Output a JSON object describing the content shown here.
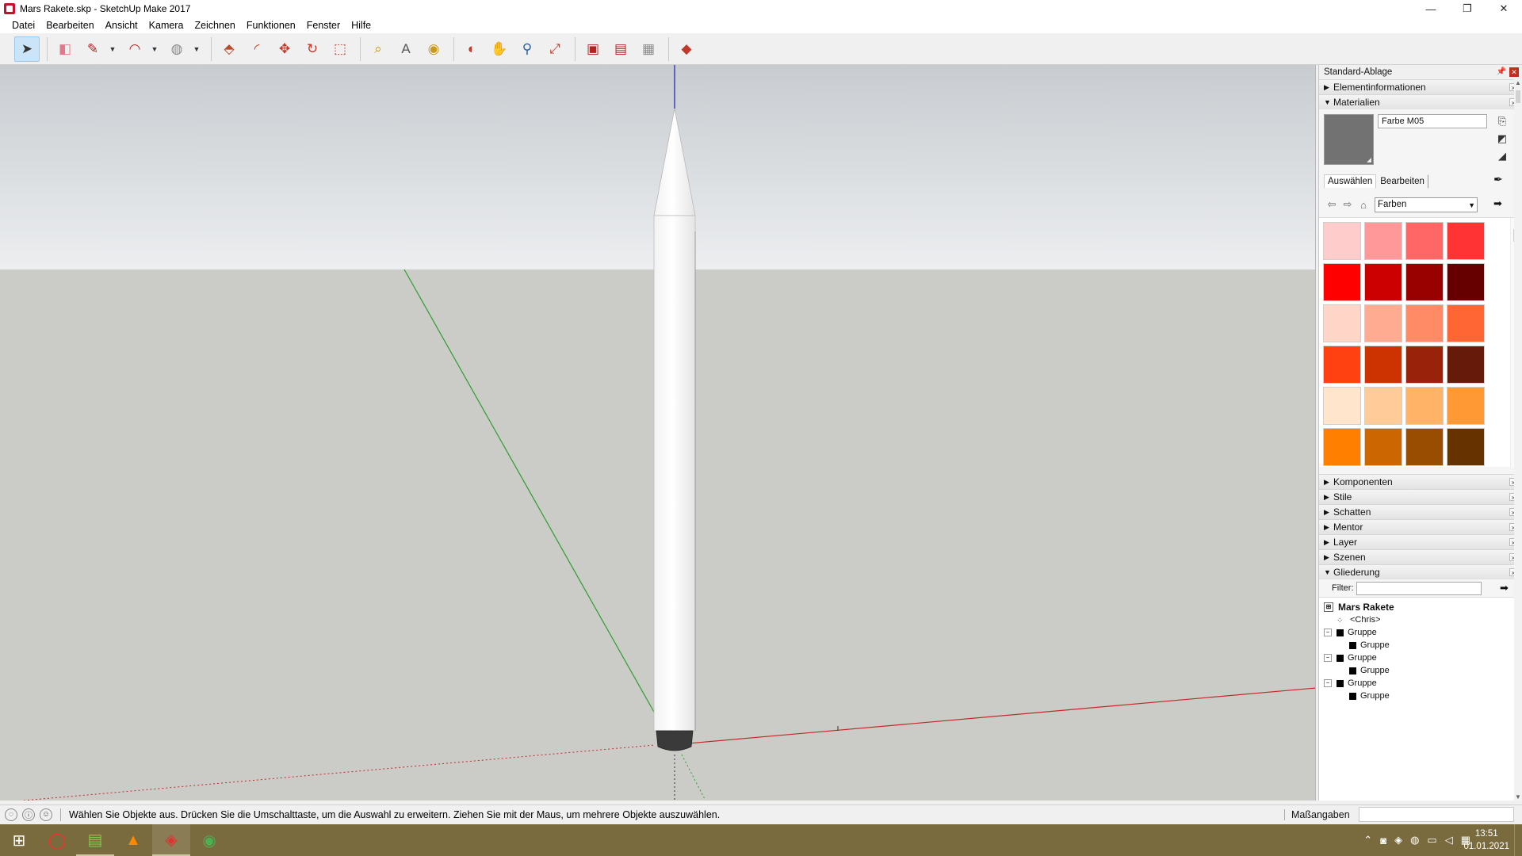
{
  "window": {
    "title": "Mars Rakete.skp - SketchUp Make 2017",
    "controls": {
      "minimize": "—",
      "maximize": "❐",
      "close": "✕"
    }
  },
  "menubar": {
    "items": [
      "Datei",
      "Bearbeiten",
      "Ansicht",
      "Kamera",
      "Zeichnen",
      "Funktionen",
      "Fenster",
      "Hilfe"
    ]
  },
  "toolbar": {
    "tools": [
      {
        "icon": "select-arrow-icon",
        "glyph": "➤",
        "color": "#333333"
      },
      {
        "icon": "eraser-icon",
        "glyph": "◧",
        "color": "#e07a8a"
      },
      {
        "icon": "pencil-line-icon",
        "glyph": "✎",
        "color": "#b22222"
      },
      {
        "icon": "arc-icon",
        "glyph": "◠",
        "color": "#b22222"
      },
      {
        "icon": "shapes-icon",
        "glyph": "◍",
        "color": "#8a8a8a"
      },
      {
        "icon": "push-pull-icon",
        "glyph": "⬘",
        "color": "#b84a2a"
      },
      {
        "icon": "offset-icon",
        "glyph": "◜",
        "color": "#c04020"
      },
      {
        "icon": "move-icon",
        "glyph": "✥",
        "color": "#c0392b"
      },
      {
        "icon": "rotate-icon",
        "glyph": "↻",
        "color": "#c0392b"
      },
      {
        "icon": "scale-icon",
        "glyph": "⬚",
        "color": "#c0392b"
      },
      {
        "icon": "tape-measure-icon",
        "glyph": "⌕",
        "color": "#c99a1a"
      },
      {
        "icon": "text-icon",
        "glyph": "A",
        "color": "#555555"
      },
      {
        "icon": "paint-bucket-icon",
        "glyph": "◉",
        "color": "#c99a1a"
      },
      {
        "icon": "orbit-icon",
        "glyph": "◐",
        "color": "#c0392b"
      },
      {
        "icon": "pan-icon",
        "glyph": "✋",
        "color": "#d4a017"
      },
      {
        "icon": "zoom-icon",
        "glyph": "⚲",
        "color": "#2b5fa6"
      },
      {
        "icon": "zoom-extents-icon",
        "glyph": "⤢",
        "color": "#c0392b"
      },
      {
        "icon": "3d-warehouse-icon",
        "glyph": "▣",
        "color": "#b22222"
      },
      {
        "icon": "extension-warehouse-icon",
        "glyph": "▤",
        "color": "#b22222"
      },
      {
        "icon": "layout-send-icon",
        "glyph": "▦",
        "color": "#8a8a8a"
      },
      {
        "icon": "extension-ruby-icon",
        "glyph": "◆",
        "color": "#c0392b"
      }
    ]
  },
  "tray": {
    "title": "Standard-Ablage",
    "panels": {
      "element_info": "Elementinformationen",
      "materials": "Materialien",
      "components": "Komponenten",
      "styles": "Stile",
      "shadows": "Schatten",
      "mentor": "Mentor",
      "layers": "Layer",
      "scenes": "Szenen",
      "outliner": "Gliederung"
    },
    "materials": {
      "current_name": "Farbe M05",
      "preview_color": "#727272",
      "tab_select": "Auswählen",
      "tab_edit": "Bearbeiten",
      "collection": "Farben",
      "swatches": [
        "#ffcccc",
        "#ff9999",
        "#ff6666",
        "#ff3333",
        "#ff0000",
        "#cc0000",
        "#990000",
        "#660000",
        "#ffd5c8",
        "#ffab91",
        "#ff8a65",
        "#ff6633",
        "#ff4010",
        "#cc3300",
        "#99220a",
        "#661a0a",
        "#ffe5cc",
        "#ffcc99",
        "#ffb366",
        "#ff9933",
        "#ff8000",
        "#cc6600",
        "#994d00",
        "#663300"
      ]
    },
    "outliner": {
      "filter_label": "Filter:",
      "filter_value": "",
      "model_name": "Mars Rakete",
      "items": [
        {
          "label": "<Chris>",
          "level": 1,
          "kind": "component",
          "expander": ""
        },
        {
          "label": "Gruppe",
          "level": 1,
          "kind": "group",
          "expander": "−"
        },
        {
          "label": "Gruppe",
          "level": 2,
          "kind": "group",
          "expander": ""
        },
        {
          "label": "Gruppe",
          "level": 1,
          "kind": "group",
          "expander": "−"
        },
        {
          "label": "Gruppe",
          "level": 2,
          "kind": "group",
          "expander": ""
        },
        {
          "label": "Gruppe",
          "level": 1,
          "kind": "group",
          "expander": "−"
        },
        {
          "label": "Gruppe",
          "level": 2,
          "kind": "group",
          "expander": ""
        }
      ]
    }
  },
  "statusbar": {
    "message": "Wählen Sie Objekte aus. Drücken Sie die Umschalttaste, um die Auswahl zu erweitern. Ziehen Sie mit der Maus, um mehrere Objekte auszuwählen.",
    "measurements_label": "Maßangaben",
    "measurements_value": ""
  },
  "taskbar": {
    "apps": [
      {
        "icon": "windows-start-icon",
        "glyph": "⊞",
        "color": "#ffffff"
      },
      {
        "icon": "opera-icon",
        "glyph": "◯",
        "color": "#ff2a2a"
      },
      {
        "icon": "notepad-icon",
        "glyph": "▤",
        "color": "#7ec850"
      },
      {
        "icon": "vlc-icon",
        "glyph": "▲",
        "color": "#ff8800"
      },
      {
        "icon": "sketchup-icon",
        "glyph": "◈",
        "color": "#e03030"
      },
      {
        "icon": "chrome-icon",
        "glyph": "◉",
        "color": "#4caf50"
      }
    ],
    "time": "13:51",
    "date": "01.01.2021"
  },
  "colors": {
    "sky_top": "#c8ccd0",
    "sky_bottom": "#eceef0",
    "ground": "#cbcbc7",
    "axis_red": "#c62828",
    "axis_green": "#2e9e2e",
    "axis_blue": "#1a1ab0"
  }
}
